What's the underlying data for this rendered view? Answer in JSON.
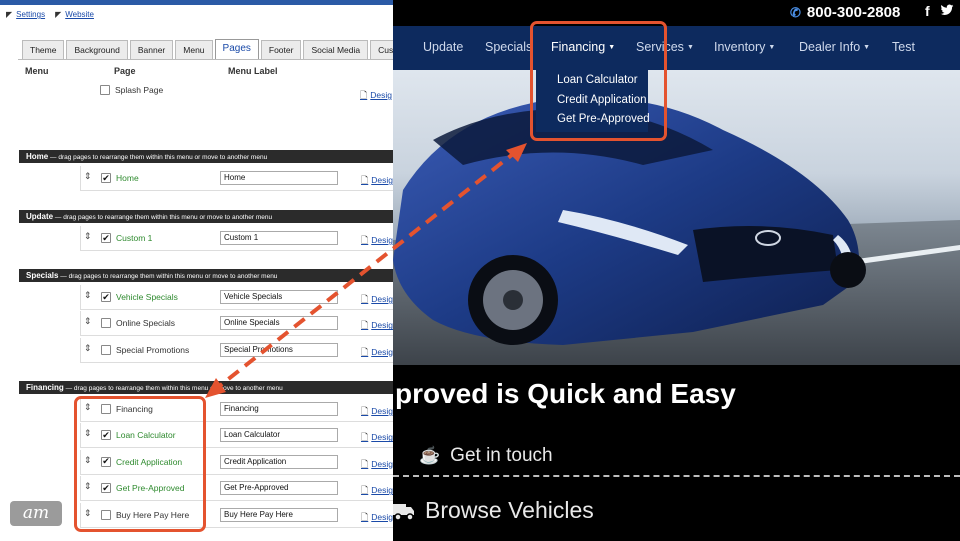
{
  "admin": {
    "top_links": [
      "Settings",
      "Website"
    ],
    "tabs": [
      {
        "label": "Theme",
        "active": false
      },
      {
        "label": "Background",
        "active": false
      },
      {
        "label": "Banner",
        "active": false
      },
      {
        "label": "Menu",
        "active": false
      },
      {
        "label": "Pages",
        "active": true
      },
      {
        "label": "Footer",
        "active": false
      },
      {
        "label": "Social Media",
        "active": false
      },
      {
        "label": "Custom SE",
        "active": false
      }
    ],
    "columns": {
      "menu": "Menu",
      "page": "Page",
      "menu_label": "Menu Label"
    },
    "splash_page": "Splash Page",
    "design_label": "Desig",
    "sections": [
      {
        "name": "Home",
        "hint": " — drag pages to rearrange them within this menu or move to another menu",
        "rows": [
          {
            "page": "Home",
            "checked": true,
            "label": "Home"
          }
        ]
      },
      {
        "name": "Update",
        "hint": " — drag pages to rearrange them within this menu or move to another menu",
        "rows": [
          {
            "page": "Custom 1",
            "checked": true,
            "label": "Custom 1"
          }
        ]
      },
      {
        "name": "Specials",
        "hint": " — drag pages to rearrange them within this menu or move to another menu",
        "rows": [
          {
            "page": "Vehicle Specials",
            "checked": true,
            "label": "Vehicle Specials"
          },
          {
            "page": "Online Specials",
            "checked": false,
            "label": "Online Specials"
          },
          {
            "page": "Special Promotions",
            "checked": false,
            "label": "Special Promotions"
          }
        ]
      },
      {
        "name": "Financing",
        "hint": " — drag pages to rearrange them within this menu or move to another menu",
        "rows": [
          {
            "page": "Financing",
            "checked": false,
            "label": "Financing"
          },
          {
            "page": "Loan Calculator",
            "checked": true,
            "label": "Loan Calculator"
          },
          {
            "page": "Credit Application",
            "checked": true,
            "label": "Credit Application"
          },
          {
            "page": "Get Pre-Approved",
            "checked": true,
            "label": "Get Pre-Approved"
          },
          {
            "page": "Buy Here Pay Here",
            "checked": false,
            "label": "Buy Here Pay Here"
          }
        ]
      }
    ],
    "watermark": "am"
  },
  "site": {
    "phone": "800-300-2808",
    "social": [
      "f",
      "twitter"
    ],
    "nav": [
      {
        "label": "Update",
        "caret": false
      },
      {
        "label": "Specials",
        "caret": false
      },
      {
        "label": "Financing",
        "caret": true
      },
      {
        "label": "Services",
        "caret": true
      },
      {
        "label": "Inventory",
        "caret": true
      },
      {
        "label": "Dealer Info",
        "caret": true
      },
      {
        "label": "Test",
        "caret": false
      }
    ],
    "dropdown": [
      "Loan Calculator",
      "Credit Application",
      "Get Pre-Approved"
    ],
    "headline": "proved is Quick and Easy",
    "cta_contact": "Get in touch",
    "cta_browse": "Browse Vehicles",
    "colors": {
      "nav_bg": "#0d2a5e",
      "highlight": "#e4532f",
      "car": "#1d3b86",
      "phone_icon": "#4b8fe6"
    }
  }
}
